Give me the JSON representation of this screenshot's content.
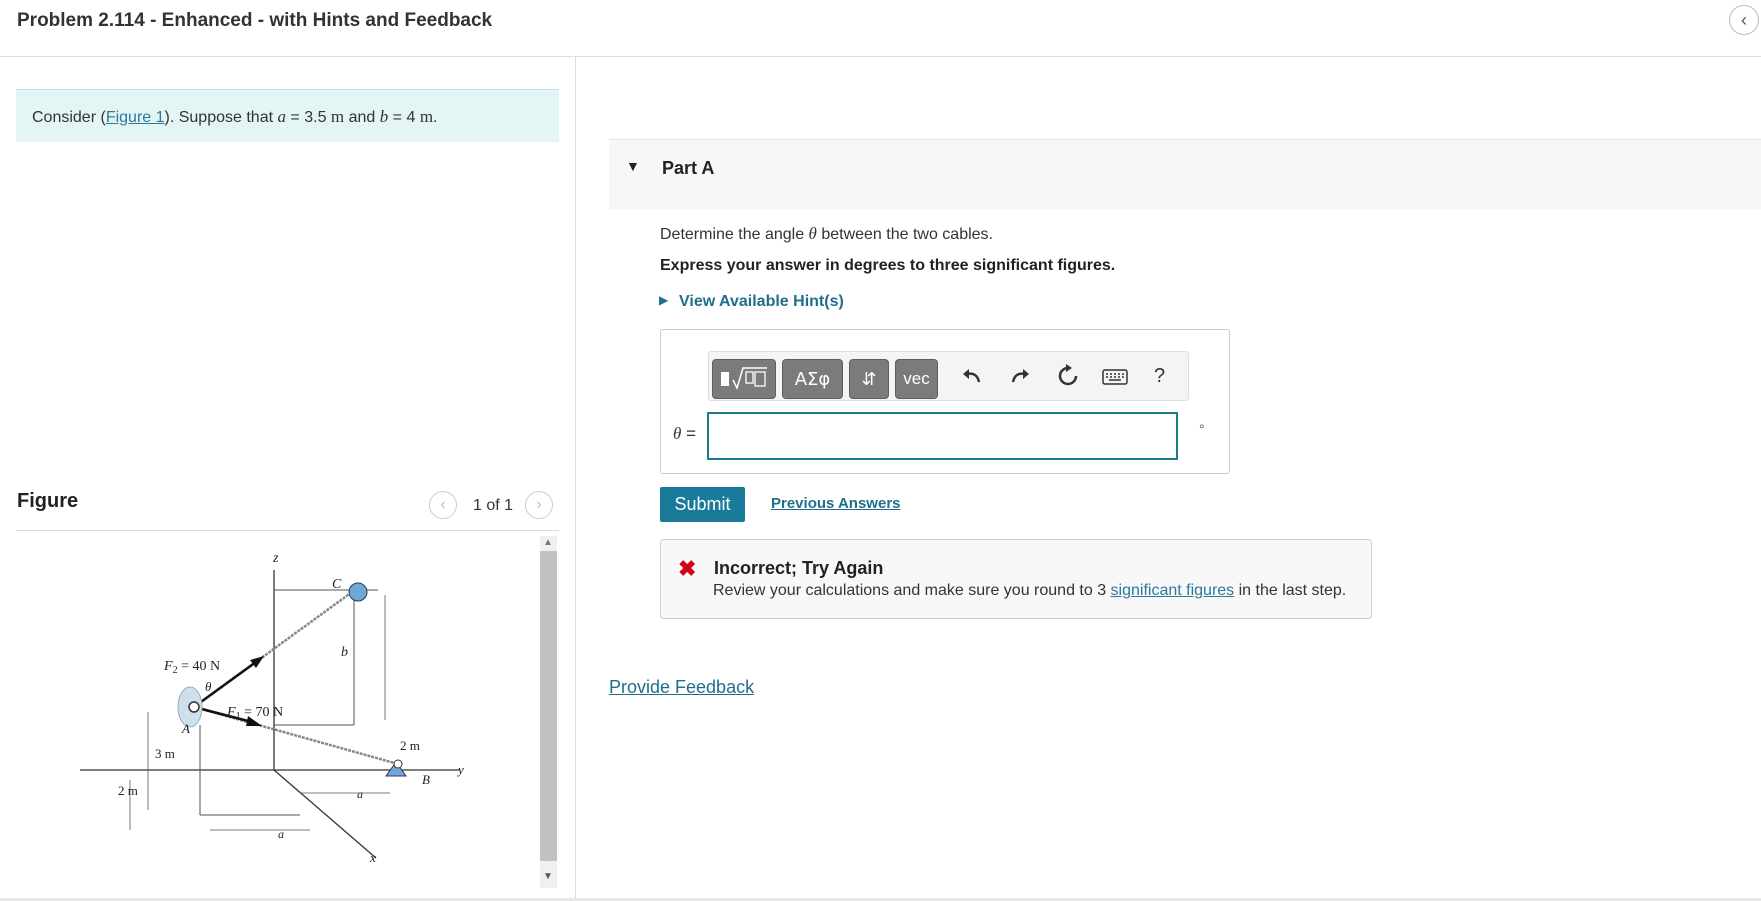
{
  "header": {
    "title": "Problem 2.114 - Enhanced - with Hints and Feedback",
    "collapse_icon": "chevron-left-icon"
  },
  "intro": {
    "prefix": "Consider (",
    "figure_link": "Figure 1",
    "mid": "). Suppose that ",
    "var_a": "a",
    "eq_a": " = 3.5 ",
    "unit_a": "m",
    "and": " and ",
    "var_b": "b",
    "eq_b": " = 4 ",
    "unit_b": "m",
    "end": "."
  },
  "figure": {
    "label": "Figure",
    "pager": "1 of 1",
    "prev_icon": "chevron-left-icon",
    "next_icon": "chevron-right-icon",
    "labels": {
      "z": "z",
      "C": "C",
      "F2": "F",
      "F2_sub": "2",
      "F2_val": " = 40 N",
      "b": "b",
      "theta": "θ",
      "F1": "F",
      "F1_sub": "1",
      "F1_val": " = 70 N",
      "A": "A",
      "two_m_right": "2 m",
      "B": "B",
      "y": "y",
      "three_m": "3 m",
      "two_m_left": "2 m",
      "a_right": "a",
      "a_bottom": "a",
      "x": "x"
    }
  },
  "part_a": {
    "title": "Part A",
    "question_pre": "Determine the angle ",
    "question_var": "θ",
    "question_post": " between the two cables.",
    "instruction": "Express your answer in degrees to three significant figures.",
    "hint_link": "View Available Hint(s)",
    "toolbar": {
      "greek_label": "ΑΣφ",
      "updown_label": "⇵",
      "vec_label": "vec",
      "help_label": "?"
    },
    "answer": {
      "var": "θ",
      "eq": " =",
      "value": "",
      "unit": "°"
    },
    "submit_label": "Submit",
    "previous_answers": "Previous Answers",
    "feedback": {
      "title": "Incorrect; Try Again",
      "msg_pre": "Review your calculations and make sure you round to 3 ",
      "msg_link": "significant figures",
      "msg_post": " in the last step."
    }
  },
  "provide_feedback": "Provide Feedback"
}
